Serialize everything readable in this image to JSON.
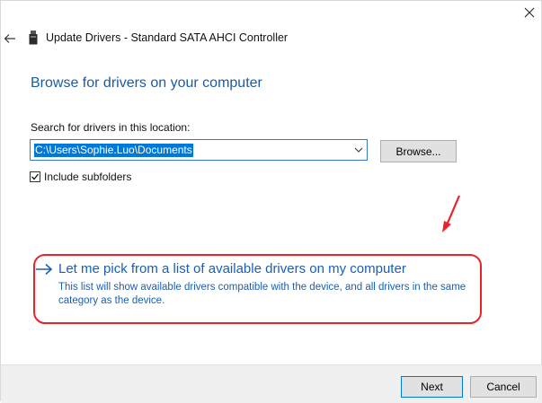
{
  "window": {
    "close_icon": "close-icon"
  },
  "header": {
    "back_icon": "back-arrow-icon",
    "device_icon": "usb-device-icon",
    "title": "Update Drivers - Standard SATA AHCI Controller"
  },
  "page": {
    "title": "Browse for drivers on your computer",
    "search_label": "Search for drivers in this location:",
    "path_value": "C:\\Users\\Sophie.Luo\\Documents",
    "browse_label": "Browse...",
    "include_subfolders_label": "Include subfolders",
    "include_subfolders_checked": true
  },
  "pick_option": {
    "title": "Let me pick from a list of available drivers on my computer",
    "description": "This list will show available drivers compatible with the device, and all drivers in the same category as the device.",
    "icon": "arrow-right-icon"
  },
  "footer": {
    "next_label": "Next",
    "cancel_label": "Cancel"
  },
  "colors": {
    "accent_blue": "#1c5a9f",
    "link_blue": "#1a5fb4",
    "annotation_red": "#e8242a",
    "selection_blue": "#0078d7"
  }
}
